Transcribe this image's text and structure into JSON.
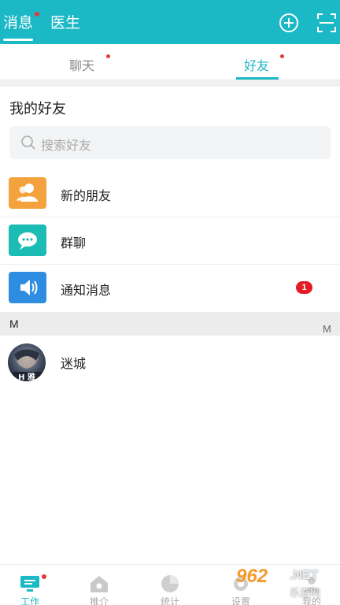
{
  "header": {
    "tabs": [
      {
        "label": "消息"
      },
      {
        "label": "医生"
      }
    ],
    "icons": [
      "add-circle-icon",
      "scan-icon"
    ]
  },
  "subtabs": [
    {
      "label": "聊天"
    },
    {
      "label": "好友"
    }
  ],
  "friends": {
    "title": "我的好友",
    "search_placeholder": "搜索好友",
    "entries": [
      {
        "label": "新的朋友",
        "icon": "new-friends-icon",
        "color": "#f4a23d"
      },
      {
        "label": "群聊",
        "icon": "group-chat-icon",
        "color": "#1bbcb4"
      },
      {
        "label": "通知消息",
        "icon": "notification-speaker-icon",
        "color": "#2e8de0",
        "badge": "1"
      }
    ],
    "groups": [
      {
        "letter": "M",
        "contacts": [
          {
            "name": "迷城"
          }
        ]
      }
    ],
    "index_letter": "M"
  },
  "bottom_nav": [
    {
      "label": "工作",
      "icon": "work-icon"
    },
    {
      "label": "推介",
      "icon": "home-icon"
    },
    {
      "label": "统计",
      "icon": "stats-pie-icon"
    },
    {
      "label": "设置",
      "icon": "settings-icon"
    },
    {
      "label": "我的",
      "icon": "profile-icon"
    }
  ],
  "watermark": {
    "brand": "962",
    "domain": ".NET",
    "site": "乐游网"
  },
  "colors": {
    "accent": "#1bb8c6",
    "badge": "#e51c23"
  }
}
